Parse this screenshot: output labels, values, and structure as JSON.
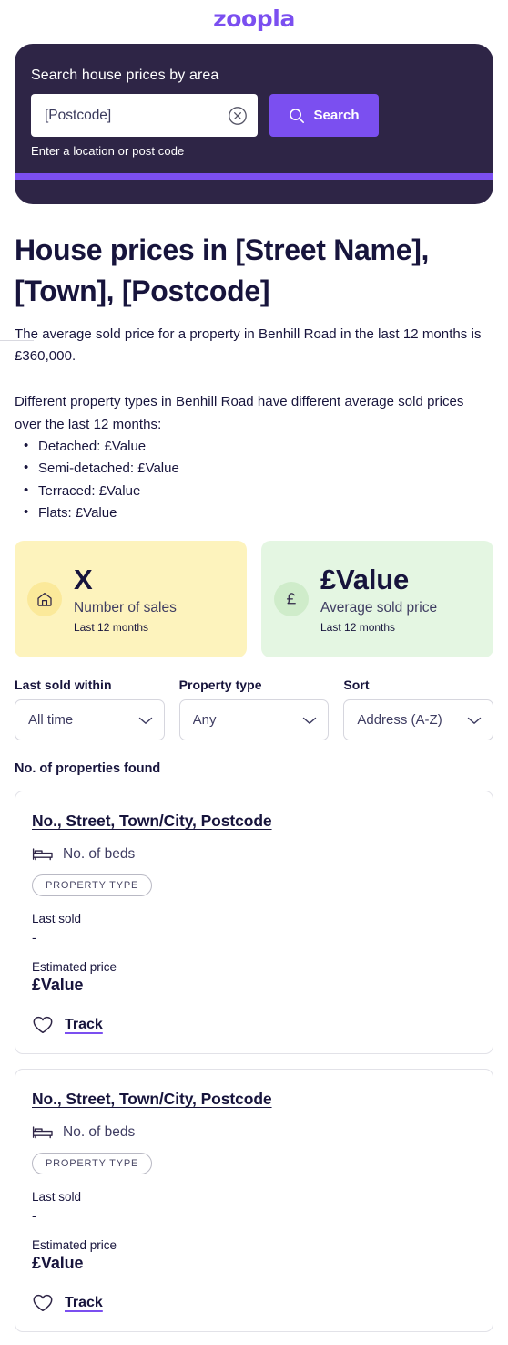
{
  "brand": {
    "logo_text": "zoopla",
    "accent_color": "#7b4ff0"
  },
  "search_panel": {
    "title": "Search house prices by area",
    "input_value": "[Postcode]",
    "input_placeholder": "[Postcode]",
    "clear_icon": "close-circle-icon",
    "search_button_label": "Search",
    "search_icon": "search-icon",
    "hint": "Enter a location or post code",
    "background_color": "#2e2546"
  },
  "page": {
    "title": "House prices in [Street Name], [Town], [Postcode]",
    "intro_paragraph": "The average sold price for a property in Benhill Road in the last 12 months is £360,000.",
    "types_intro": "Different property types in Benhill Road have different average sold prices over the last 12 months:",
    "type_prices": [
      "Detached: £Value",
      "Semi-detached: £Value",
      "Terraced: £Value",
      "Flats: £Value"
    ]
  },
  "stats": [
    {
      "icon": "home-icon",
      "value": "X",
      "label": "Number of sales",
      "sub": "Last 12 months",
      "background_color": "#fdf3bd",
      "icon_background_color": "#fbe99a"
    },
    {
      "icon": "pound-icon",
      "value": "£Value",
      "label": "Average sold price",
      "sub": "Last 12 months",
      "background_color": "#e4f6e2",
      "icon_background_color": "#cfecca"
    }
  ],
  "filters": [
    {
      "label": "Last sold within",
      "value": "All time"
    },
    {
      "label": "Property type",
      "value": "Any"
    },
    {
      "label": "Sort",
      "value": "Address (A-Z)"
    }
  ],
  "results": {
    "count_label": "No. of properties found",
    "cards": [
      {
        "address": "No., Street, Town/City, Postcode",
        "beds": "No. of beds",
        "property_type": "PROPERTY TYPE",
        "last_sold_label": "Last sold",
        "last_sold_value": "-",
        "estimated_price_label": "Estimated price",
        "estimated_price_value": "£Value",
        "track_label": "Track"
      },
      {
        "address": "No., Street, Town/City, Postcode",
        "beds": "No. of beds",
        "property_type": "PROPERTY TYPE",
        "last_sold_label": "Last sold",
        "last_sold_value": "-",
        "estimated_price_label": "Estimated price",
        "estimated_price_value": "£Value",
        "track_label": "Track"
      }
    ]
  }
}
